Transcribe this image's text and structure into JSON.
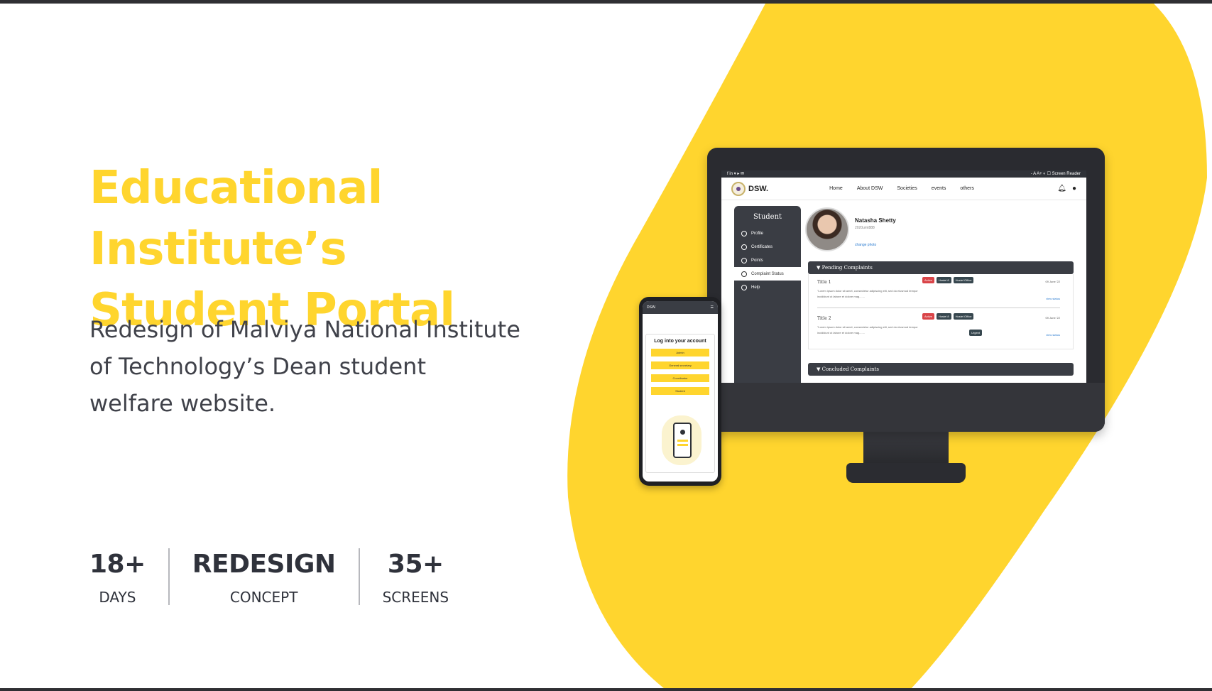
{
  "hero": {
    "title_line1": "Educational Institute’s",
    "title_line2": "Student Portal",
    "desc_line1": "Redesign of Malviya National Institute",
    "desc_line2": "of Technology’s Dean student",
    "desc_line3": "welfare website."
  },
  "stats": [
    {
      "value": "18+",
      "label": "DAYS"
    },
    {
      "value": "REDESIGN",
      "label": "CONCEPT"
    },
    {
      "value": "35+",
      "label": "SCREENS"
    }
  ],
  "desktop": {
    "util_left": "f in ▾ ▸ ✉",
    "util_right": "- A A+   ◐   ☐ Screen Reader",
    "logo": "DSW.",
    "nav": [
      "Home",
      "About DSW",
      "Societies",
      "events",
      "others"
    ],
    "sidebar_title": "Student",
    "sidebar_items": [
      "Profile",
      "Certificates",
      "Points",
      "Complaint Status",
      "Help"
    ],
    "profile": {
      "name": "Natasha Shetty",
      "id": "2020umt888",
      "change_photo": "change photo"
    },
    "pending_label": "Pending Complaints",
    "concluded_label": "Concluded Complaints",
    "complaints": [
      {
        "title": "Title 1",
        "text": "\"Lorem ipsum dolor sit amet, consectetur adipiscing elit, sed do eiusmod tempor incididunt ut labore et dolore mag.......",
        "tags": [
          "Active",
          "Hostel 8",
          "Hostel Office"
        ],
        "date": "09 June '22",
        "link": "view status"
      },
      {
        "title": "Title 2",
        "text": "\"Lorem ipsum dolor sit amet, consectetur adipiscing elit, sed do eiusmod tempor incididunt ut labore et dolore mag.......",
        "tags": [
          "Active",
          "Hostel 8",
          "Hostel Office",
          "Urgent"
        ],
        "date": "09 June '22",
        "link": "view status"
      }
    ]
  },
  "mobile": {
    "logo": "DSW.",
    "heading": "Log into your account",
    "buttons": [
      "Admin",
      "General secretary",
      "Coordinator",
      "Student"
    ]
  },
  "colors": {
    "accent_yellow": "#ffd52e",
    "dark_panel": "#3a3d44",
    "tag_red": "#d94448"
  }
}
